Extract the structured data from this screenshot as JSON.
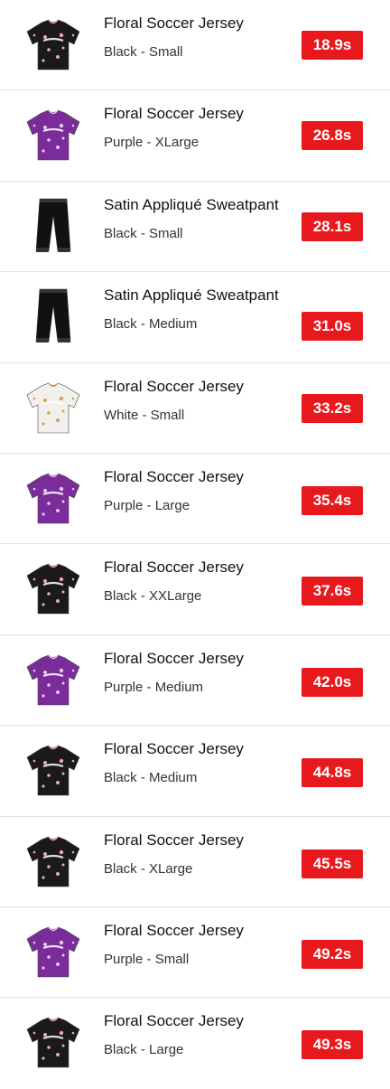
{
  "items": [
    {
      "name": "Floral Soccer Jersey",
      "variant": "Black - Small",
      "time": "18.9s",
      "kind": "jersey",
      "color": "#1a1a1a",
      "accent": "#f0a6b0"
    },
    {
      "name": "Floral Soccer Jersey",
      "variant": "Purple - XLarge",
      "time": "26.8s",
      "kind": "jersey",
      "color": "#7a2c9a",
      "accent": "#e9c6f0"
    },
    {
      "name": "Satin Appliqué Sweatpant",
      "variant": "Black - Small",
      "time": "28.1s",
      "kind": "pants",
      "color": "#111111",
      "accent": "#333333"
    },
    {
      "name": "Satin Appliqué Sweatpant",
      "variant": "Black - Medium",
      "time": "31.0s",
      "kind": "pants",
      "color": "#111111",
      "accent": "#333333"
    },
    {
      "name": "Floral Soccer Jersey",
      "variant": "White - Small",
      "time": "33.2s",
      "kind": "jersey",
      "color": "#f2f0ec",
      "accent": "#d3a35a"
    },
    {
      "name": "Floral Soccer Jersey",
      "variant": "Purple - Large",
      "time": "35.4s",
      "kind": "jersey",
      "color": "#7a2c9a",
      "accent": "#e9c6f0"
    },
    {
      "name": "Floral Soccer Jersey",
      "variant": "Black - XXLarge",
      "time": "37.6s",
      "kind": "jersey",
      "color": "#1a1a1a",
      "accent": "#f0a6b0"
    },
    {
      "name": "Floral Soccer Jersey",
      "variant": "Purple - Medium",
      "time": "42.0s",
      "kind": "jersey",
      "color": "#7a2c9a",
      "accent": "#e9c6f0"
    },
    {
      "name": "Floral Soccer Jersey",
      "variant": "Black - Medium",
      "time": "44.8s",
      "kind": "jersey",
      "color": "#1a1a1a",
      "accent": "#f0a6b0"
    },
    {
      "name": "Floral Soccer Jersey",
      "variant": "Black - XLarge",
      "time": "45.5s",
      "kind": "jersey",
      "color": "#1a1a1a",
      "accent": "#f0a6b0"
    },
    {
      "name": "Floral Soccer Jersey",
      "variant": "Purple - Small",
      "time": "49.2s",
      "kind": "jersey",
      "color": "#7a2c9a",
      "accent": "#e9c6f0"
    },
    {
      "name": "Floral Soccer Jersey",
      "variant": "Black - Large",
      "time": "49.3s",
      "kind": "jersey",
      "color": "#1a1a1a",
      "accent": "#f0a6b0"
    }
  ],
  "badge_color": "#e8191d"
}
